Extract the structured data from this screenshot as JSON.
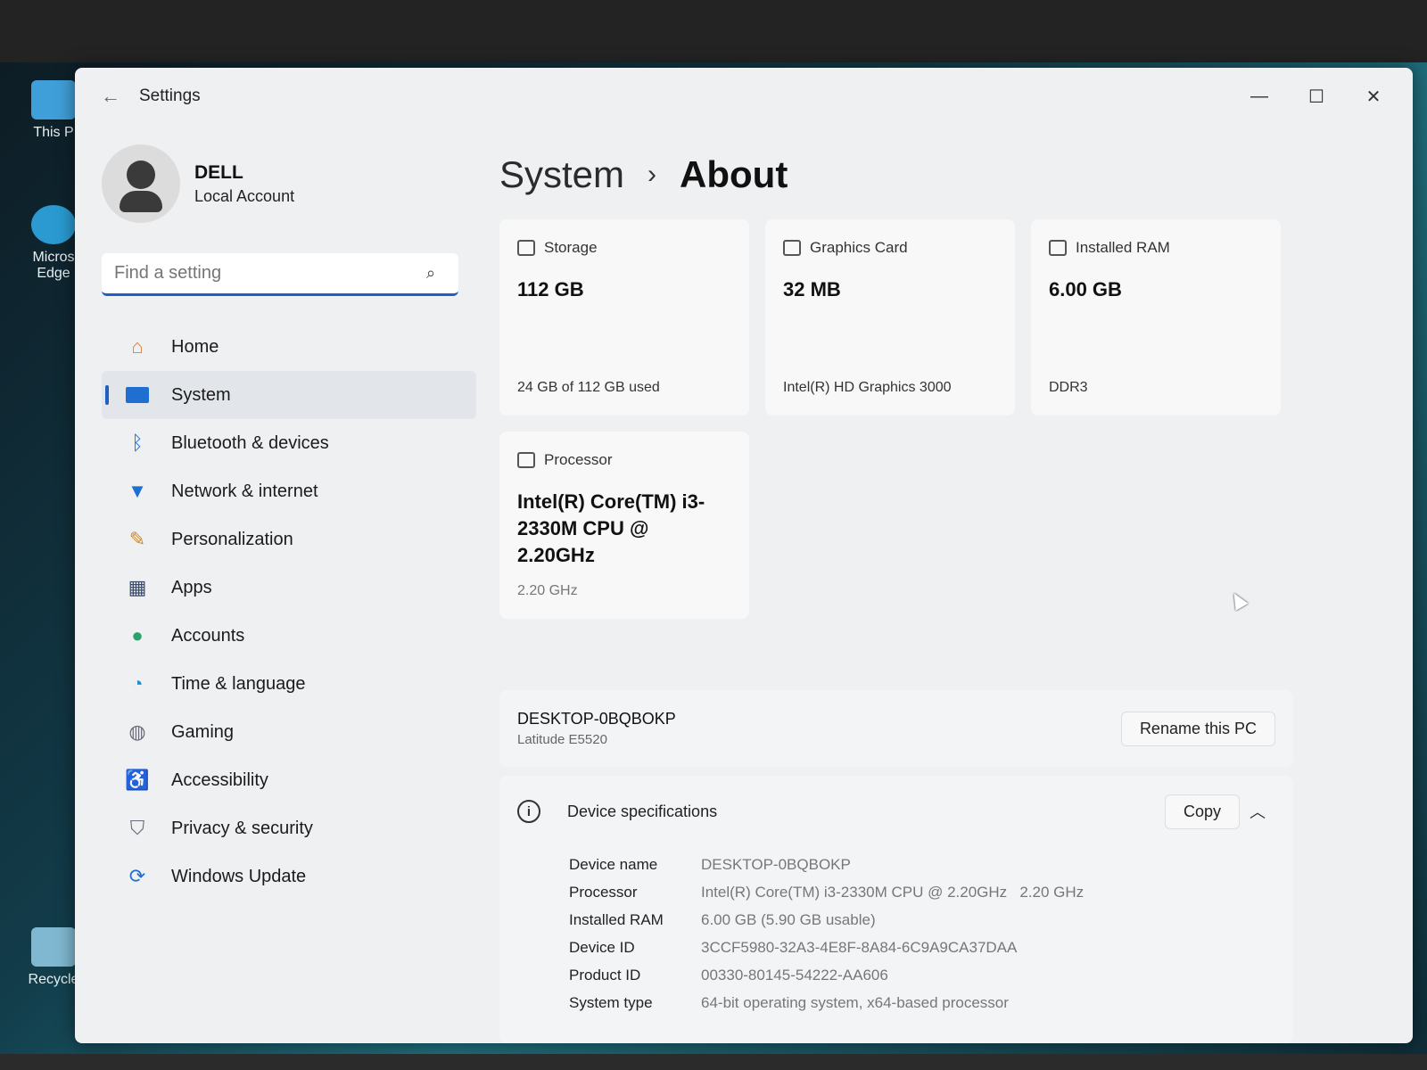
{
  "desktop": {
    "icons": [
      {
        "label": "This P"
      },
      {
        "label": "Micros Edge"
      },
      {
        "label": "Recycle"
      }
    ]
  },
  "window": {
    "title": "Settings"
  },
  "user": {
    "name": "DELL",
    "account_type": "Local Account"
  },
  "search": {
    "placeholder": "Find a setting"
  },
  "nav": {
    "items": [
      {
        "label": "Home",
        "icon": "home-icon",
        "color": "#e07a3a"
      },
      {
        "label": "System",
        "icon": "system-icon",
        "color": "#1f6fd0"
      },
      {
        "label": "Bluetooth & devices",
        "icon": "bluetooth-icon",
        "color": "#1f6fd0"
      },
      {
        "label": "Network & internet",
        "icon": "wifi-icon",
        "color": "#1f6fd0"
      },
      {
        "label": "Personalization",
        "icon": "brush-icon",
        "color": "#d0862a"
      },
      {
        "label": "Apps",
        "icon": "apps-icon",
        "color": "#3a4a6a"
      },
      {
        "label": "Accounts",
        "icon": "person-icon",
        "color": "#2aa36a"
      },
      {
        "label": "Time & language",
        "icon": "globe-clock-icon",
        "color": "#1f8fd0"
      },
      {
        "label": "Gaming",
        "icon": "controller-icon",
        "color": "#6a6a7a"
      },
      {
        "label": "Accessibility",
        "icon": "accessibility-icon",
        "color": "#1f6fd0"
      },
      {
        "label": "Privacy & security",
        "icon": "shield-icon",
        "color": "#6a6a7a"
      },
      {
        "label": "Windows Update",
        "icon": "update-icon",
        "color": "#1f6fd0"
      }
    ]
  },
  "breadcrumb": {
    "parent": "System",
    "separator": "›",
    "current": "About"
  },
  "cards": {
    "storage": {
      "label": "Storage",
      "value": "112 GB",
      "detail": "24 GB of 112 GB used"
    },
    "graphics": {
      "label": "Graphics Card",
      "value": "32 MB",
      "detail": "Intel(R) HD Graphics 3000"
    },
    "ram": {
      "label": "Installed RAM",
      "value": "6.00 GB",
      "detail": "DDR3"
    },
    "processor": {
      "label": "Processor",
      "value": "Intel(R) Core(TM) i3-2330M CPU @ 2.20GHz",
      "detail": "2.20 GHz"
    }
  },
  "pc": {
    "name": "DESKTOP-0BQBOKP",
    "model": "Latitude E5520",
    "rename_label": "Rename this PC"
  },
  "specs": {
    "title": "Device specifications",
    "copy_label": "Copy",
    "rows": [
      {
        "key": "Device name",
        "value": "DESKTOP-0BQBOKP"
      },
      {
        "key": "Processor",
        "value": "Intel(R) Core(TM) i3-2330M CPU @ 2.20GHz   2.20 GHz"
      },
      {
        "key": "Installed RAM",
        "value": "6.00 GB (5.90 GB usable)"
      },
      {
        "key": "Device ID",
        "value": "3CCF5980-32A3-4E8F-8A84-6C9A9CA37DAA"
      },
      {
        "key": "Product ID",
        "value": "00330-80145-54222-AA606"
      },
      {
        "key": "System type",
        "value": "64-bit operating system, x64-based processor"
      }
    ]
  }
}
